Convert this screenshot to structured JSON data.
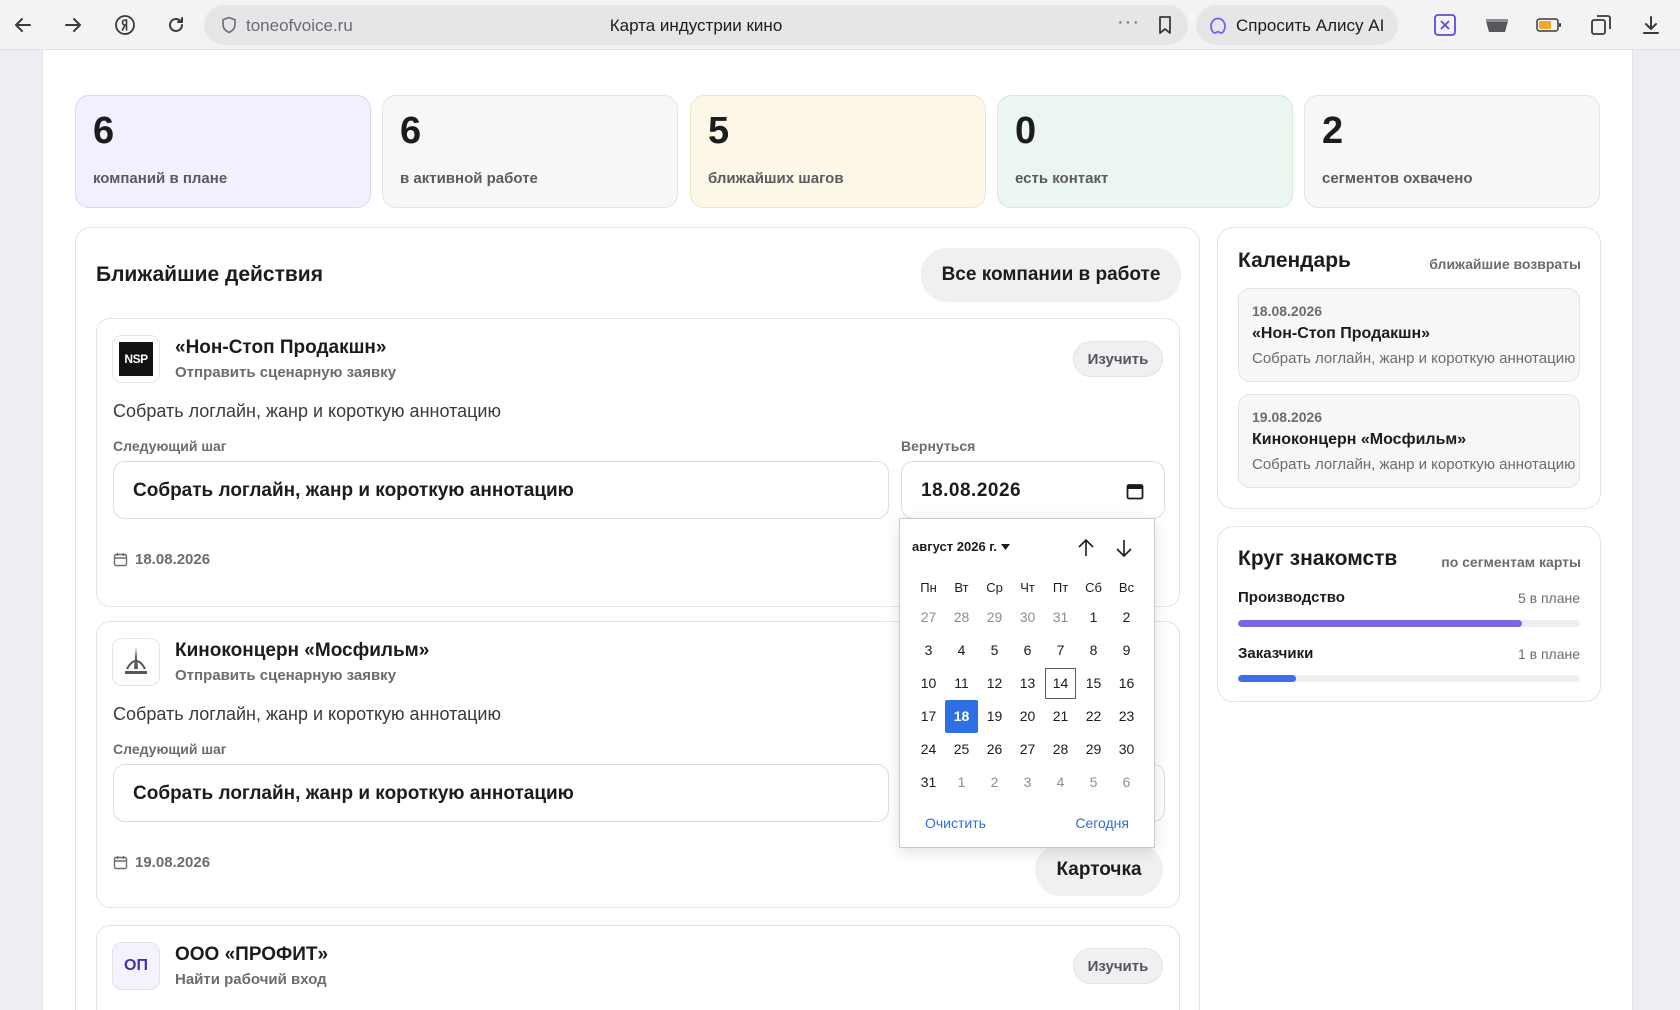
{
  "browser": {
    "domain": "toneofvoice.ru",
    "title": "Карта индустрии кино",
    "alice_label": "Спросить Алису AI"
  },
  "stats": [
    {
      "value": "6",
      "label": "компаний в плане",
      "color": "#f1f0fd",
      "border": "#d9d6f5"
    },
    {
      "value": "6",
      "label": "в активной работе",
      "color": "#f7f7f8",
      "border": "#e3e4e8"
    },
    {
      "value": "5",
      "label": "ближайших шагов",
      "color": "#fdf7e8",
      "border": "#f1e4c4"
    },
    {
      "value": "0",
      "label": "есть контакт",
      "color": "#ecf6f0",
      "border": "#d3eadc"
    },
    {
      "value": "2",
      "label": "сегментов охвачено",
      "color": "#f7f7f8",
      "border": "#e3e4e8"
    }
  ],
  "actions": {
    "title": "Ближайшие действия",
    "all_button": "Все компании в работе",
    "cards": [
      {
        "logo_text": "NSP",
        "company": "«Нон-Стоп Продакшн»",
        "subtitle": "Отправить сценарную заявку",
        "study_label": "Изучить",
        "description": "Собрать логлайн, жанр и короткую аннотацию",
        "next_step_label": "Следующий шаг",
        "next_step_value": "Собрать логлайн, жанр и короткую аннотацию",
        "return_label": "Вернуться",
        "return_value": "18.08.2026",
        "date": "18.08.2026"
      },
      {
        "logo_text": "",
        "company": "Киноконцерн «Мосфильм»",
        "subtitle": "Отправить сценарную заявку",
        "description": "Собрать логлайн, жанр и короткую аннотацию",
        "next_step_label": "Следующий шаг",
        "next_step_value": "Собрать логлайн, жанр и короткую аннотацию",
        "date": "19.08.2026",
        "card_button": "Карточка"
      },
      {
        "logo_text": "ОП",
        "company": "ООО «ПРОФИТ»",
        "subtitle": "Найти рабочий вход",
        "study_label": "Изучить"
      }
    ]
  },
  "calendar": {
    "title": "Календарь",
    "subtitle": "ближайшие возвраты",
    "items": [
      {
        "date": "18.08.2026",
        "name": "«Нон-Стоп Продакшн»",
        "desc": "Собрать логлайн, жанр и короткую аннотацию"
      },
      {
        "date": "19.08.2026",
        "name": "Киноконцерн «Мосфильм»",
        "desc": "Собрать логлайн, жанр и короткую аннотацию"
      }
    ]
  },
  "network": {
    "title": "Круг знакомств",
    "subtitle": "по сегментам карты",
    "segments": [
      {
        "name": "Производство",
        "count": "5 в плане",
        "fill": 0.83,
        "color": "#7b64e6"
      },
      {
        "name": "Заказчики",
        "count": "1 в плане",
        "fill": 0.17,
        "color": "#3d6fe8"
      }
    ]
  },
  "datepicker": {
    "month": "август 2026 г.",
    "weekdays": [
      "Пн",
      "Вт",
      "Ср",
      "Чт",
      "Пт",
      "Сб",
      "Вс"
    ],
    "days": [
      {
        "d": "27",
        "out": true
      },
      {
        "d": "28",
        "out": true
      },
      {
        "d": "29",
        "out": true
      },
      {
        "d": "30",
        "out": true
      },
      {
        "d": "31",
        "out": true
      },
      {
        "d": "1"
      },
      {
        "d": "2"
      },
      {
        "d": "3"
      },
      {
        "d": "4"
      },
      {
        "d": "5"
      },
      {
        "d": "6"
      },
      {
        "d": "7"
      },
      {
        "d": "8"
      },
      {
        "d": "9"
      },
      {
        "d": "10"
      },
      {
        "d": "11"
      },
      {
        "d": "12"
      },
      {
        "d": "13"
      },
      {
        "d": "14",
        "today": true
      },
      {
        "d": "15"
      },
      {
        "d": "16"
      },
      {
        "d": "17"
      },
      {
        "d": "18",
        "selected": true
      },
      {
        "d": "19"
      },
      {
        "d": "20"
      },
      {
        "d": "21"
      },
      {
        "d": "22"
      },
      {
        "d": "23"
      },
      {
        "d": "24"
      },
      {
        "d": "25"
      },
      {
        "d": "26"
      },
      {
        "d": "27"
      },
      {
        "d": "28"
      },
      {
        "d": "29"
      },
      {
        "d": "30"
      },
      {
        "d": "31"
      },
      {
        "d": "1",
        "out": true
      },
      {
        "d": "2",
        "out": true
      },
      {
        "d": "3",
        "out": true
      },
      {
        "d": "4",
        "out": true
      },
      {
        "d": "5",
        "out": true
      },
      {
        "d": "6",
        "out": true
      }
    ],
    "clear_label": "Очистить",
    "today_label": "Сегодня"
  }
}
